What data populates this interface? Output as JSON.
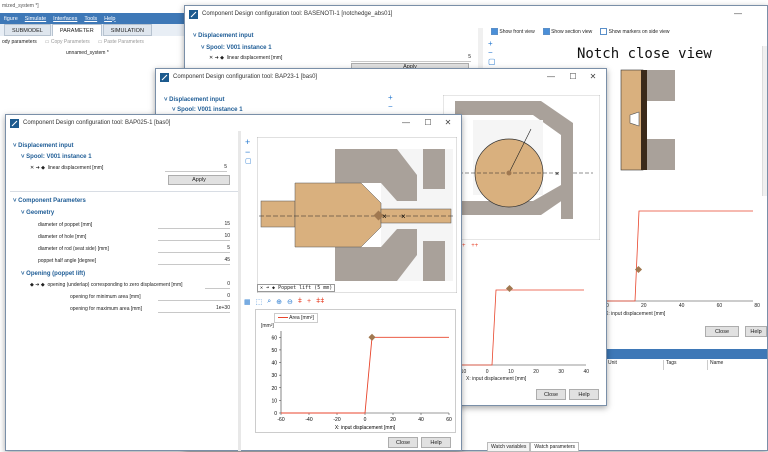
{
  "main": {
    "title": "mized_system *]",
    "menu": [
      "figure",
      "Simulate",
      "Interfaces",
      "Tools",
      "Help"
    ],
    "tabs": [
      "SUBMODEL",
      "PARAMETER",
      "SIMULATION"
    ],
    "active_tab": "PARAMETER",
    "left_label": "ody parameters",
    "copy_label": "Copy Parameters",
    "paste_label": "Paste Parameters",
    "system_name": "unnamed_system *"
  },
  "w1": {
    "title": "Component Design configuration tool: BASENOTI-1 [notchedge_abs01]",
    "disp_header": "Displacement input",
    "spool": "Spool: V001 instance 1",
    "linear_label": "linear displacement [mm]",
    "linear_value": "5",
    "apply": "Apply",
    "show_front": "Show front view",
    "show_section": "Show section view",
    "show_markers": "Show markers on side view",
    "view_title": "Notch close view",
    "table_headers": [
      "Unit",
      "Tags",
      "Name"
    ],
    "bottom_tabs": [
      "Watch variables",
      "Watch parameters"
    ],
    "x_ticks": [
      "0",
      "20",
      "40",
      "60",
      "80"
    ],
    "x_label": "X: input displacement [mm]",
    "close": "Close",
    "help": "Help"
  },
  "w2": {
    "title": "Component Design configuration tool: BAP23-1 [bas0]",
    "disp_header": "Displacement input",
    "spool": "Spool: V001 instance 1",
    "x_ticks": [
      "-10",
      "0",
      "10",
      "20",
      "30",
      "40"
    ],
    "x_label": "X: input displacement [mm]",
    "close": "Close",
    "help": "Help"
  },
  "w3": {
    "title": "Component Design configuration tool: BAP025-1 [bas0]",
    "disp_header": "Displacement input",
    "spool": "Spool: V001 instance 1",
    "linear_label": "linear displacement [mm]",
    "linear_value": "5",
    "apply": "Apply",
    "comp_header": "Component Parameters",
    "geometry": "Geometry",
    "params": [
      {
        "label": "diameter of poppet [mm]",
        "value": "15"
      },
      {
        "label": "diameter of hole [mm]",
        "value": "10"
      },
      {
        "label": "diameter of rod (seat side) [mm]",
        "value": "5"
      },
      {
        "label": "poppet half angle [degree]",
        "value": "45"
      }
    ],
    "opening_header": "Opening (poppet lift)",
    "opening_rows": [
      {
        "label": "opening (underlap) corresponding to zero displacement [mm]",
        "value": "0"
      },
      {
        "label": "opening for minimum area [mm]",
        "value": "0"
      },
      {
        "label": "opening for maximum area [mm]",
        "value": "1e+30"
      }
    ],
    "poppet_lift": "Poppet lift (5 mm)",
    "legend": "Area [mm²]",
    "y_unit": "[mm²]",
    "close": "Close",
    "help": "Help"
  },
  "chart_data": {
    "type": "line",
    "series": [
      {
        "name": "Area [mm²]",
        "x": [
          -60,
          0,
          5,
          60
        ],
        "y": [
          0,
          0,
          60,
          60
        ]
      }
    ],
    "marker": {
      "x": 5,
      "y": 60
    },
    "x_ticks": [
      "-60",
      "-40",
      "-20",
      "0",
      "20",
      "40",
      "60"
    ],
    "y_ticks": [
      "0",
      "10",
      "20",
      "30",
      "40",
      "50",
      "60"
    ],
    "xlabel": "X: input displacement [mm]",
    "ylabel": "[mm²]",
    "xlim": [
      -60,
      60
    ],
    "ylim": [
      0,
      65
    ],
    "colors": {
      "line": "#e8452c",
      "marker": "#a07850"
    }
  }
}
